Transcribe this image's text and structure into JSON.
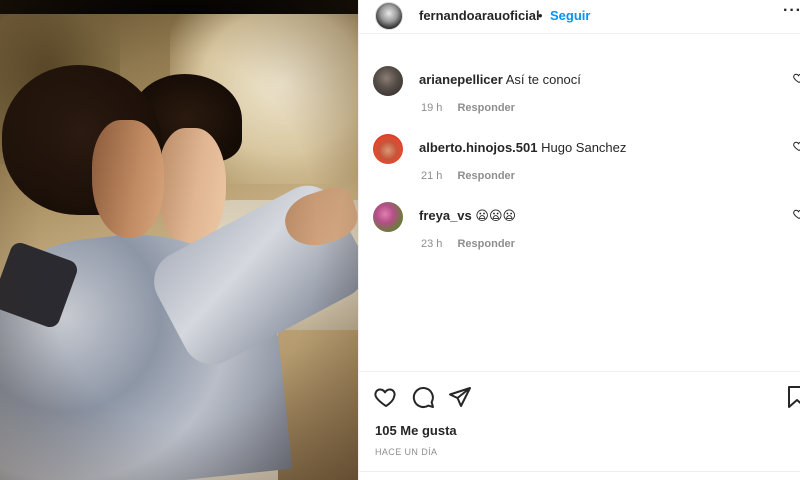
{
  "post": {
    "username": "fernandoarauoficial",
    "separator": "•",
    "follow_label": "Seguir",
    "more_label": "···"
  },
  "comments": [
    {
      "user": "arianepellicer",
      "text": "Así te conocí",
      "time": "19 h",
      "reply_label": "Responder"
    },
    {
      "user": "alberto.hinojos.501",
      "text": "Hugo Sanchez",
      "time": "21 h",
      "reply_label": "Responder"
    },
    {
      "user": "freya_vs",
      "text": "😦😦😦",
      "time": "23 h",
      "reply_label": "Responder"
    }
  ],
  "actions": {
    "icons": [
      "heart-icon",
      "comment-icon",
      "share-icon",
      "bookmark-icon"
    ],
    "likes_label": "105 Me gusta",
    "date_label": "HACE UN DÍA"
  },
  "colors": {
    "link_blue": "#0095f6",
    "text_primary": "#262626",
    "text_secondary": "#8e8e8e",
    "divider": "#efefef"
  }
}
